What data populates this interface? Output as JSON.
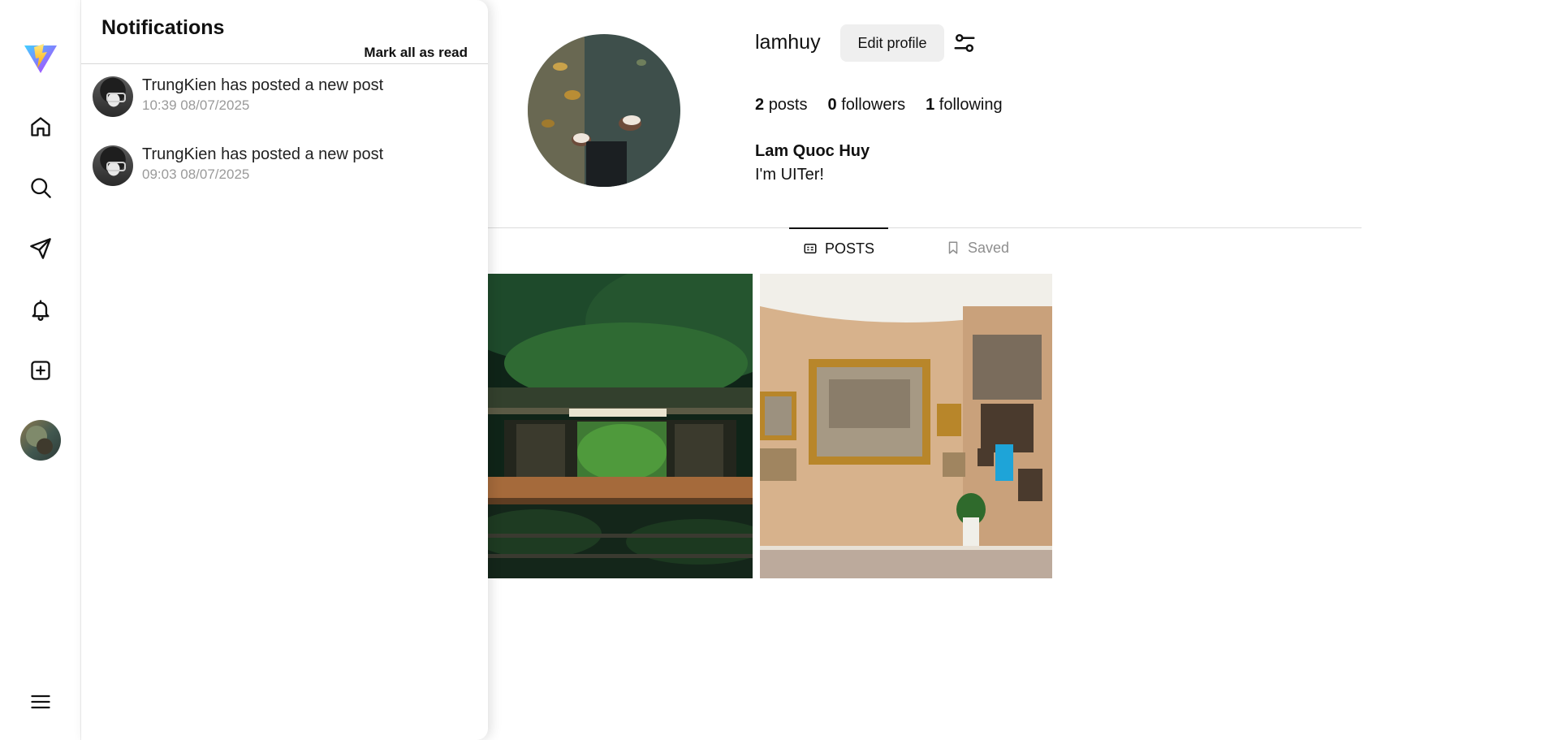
{
  "sidebar": {
    "items": [
      {
        "name": "home",
        "icon": "home-icon"
      },
      {
        "name": "search",
        "icon": "search-icon"
      },
      {
        "name": "messages",
        "icon": "send-icon"
      },
      {
        "name": "notifications",
        "icon": "bell-icon"
      },
      {
        "name": "create",
        "icon": "plus-square-icon"
      },
      {
        "name": "profile",
        "icon": "avatar"
      },
      {
        "name": "more",
        "icon": "menu-icon"
      }
    ]
  },
  "notifications": {
    "title": "Notifications",
    "mark_all_label": "Mark all as read",
    "items": [
      {
        "message": "TrungKien has posted a new post",
        "time": "10:39 08/07/2025"
      },
      {
        "message": "TrungKien has posted a new post",
        "time": "09:03 08/07/2025"
      }
    ]
  },
  "profile": {
    "username": "lamhuy",
    "edit_label": "Edit profile",
    "posts_count": "2",
    "posts_label": "posts",
    "followers_count": "0",
    "followers_label": "followers",
    "following_count": "1",
    "following_label": "following",
    "display_name": "Lam Quoc Huy",
    "bio": "I'm UITer!"
  },
  "tabs": {
    "posts": "POSTS",
    "saved": "Saved"
  },
  "colors": {
    "accent_logo": "#a855f7",
    "tab_active": "#111111",
    "tab_inactive": "#8e8e8e",
    "button_bg": "#efefef"
  }
}
